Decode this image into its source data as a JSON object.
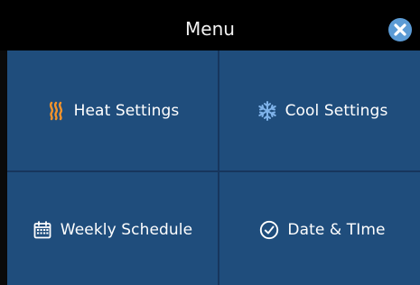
{
  "header": {
    "title": "Menu",
    "close_icon": "close-icon",
    "close_color": "#5b9bd5"
  },
  "tiles": [
    {
      "label": "Heat Settings",
      "icon": "heat-icon",
      "icon_color": "#f5942b"
    },
    {
      "label": "Cool Settings",
      "icon": "snowflake-icon",
      "icon_color": "#7fb3ea"
    },
    {
      "label": "Weekly Schedule",
      "icon": "calendar-icon",
      "icon_color": "#ffffff"
    },
    {
      "label": "Date & TIme",
      "icon": "clock-icon",
      "icon_color": "#ffffff"
    }
  ],
  "colors": {
    "header_bg": "#000000",
    "tile_bg": "#1f4d7c",
    "divider": "#17365d",
    "text": "#ffffff"
  }
}
